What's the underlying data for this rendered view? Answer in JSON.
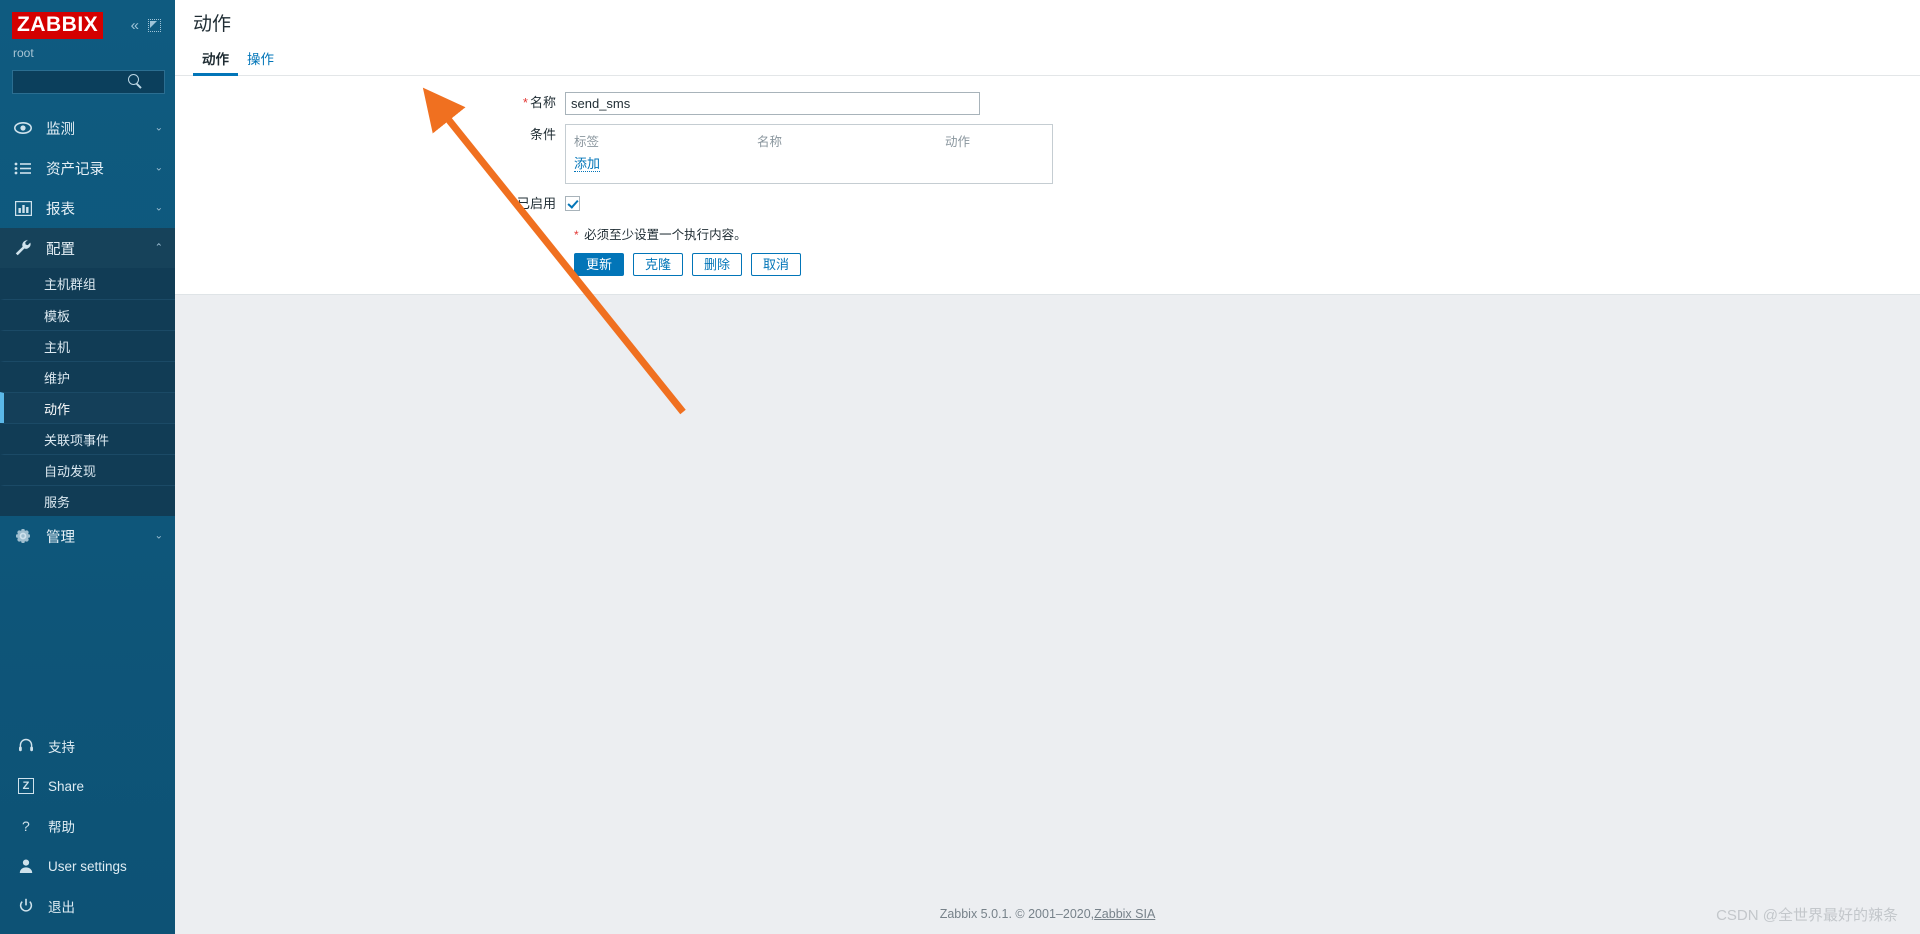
{
  "sidebar": {
    "logo": "ZABBIX",
    "user": "root",
    "search_placeholder": "",
    "search_value": "",
    "collapse_icon": "chevron-double-left-icon",
    "hide_icon": "collapse-sidebar-icon",
    "nav": [
      {
        "label": "监测",
        "icon": "eye-icon",
        "active": false,
        "chevron": "⌄"
      },
      {
        "label": "资产记录",
        "icon": "list-icon",
        "active": false,
        "chevron": "⌄"
      },
      {
        "label": "报表",
        "icon": "bar-chart-icon",
        "active": false,
        "chevron": "⌄"
      },
      {
        "label": "配置",
        "icon": "wrench-icon",
        "active": true,
        "chevron": "⌃"
      }
    ],
    "submenu": [
      {
        "label": "主机群组",
        "selected": false
      },
      {
        "label": "模板",
        "selected": false
      },
      {
        "label": "主机",
        "selected": false
      },
      {
        "label": "维护",
        "selected": false
      },
      {
        "label": "动作",
        "selected": true
      },
      {
        "label": "关联项事件",
        "selected": false
      },
      {
        "label": "自动发现",
        "selected": false
      },
      {
        "label": "服务",
        "selected": false
      }
    ],
    "nav_admin": {
      "label": "管理",
      "icon": "gear-icon",
      "chevron": "⌄"
    },
    "bottom": [
      {
        "label": "支持",
        "icon": "headset-icon"
      },
      {
        "label": "Share",
        "icon": "share-z-icon"
      },
      {
        "label": "帮助",
        "icon": "question-icon"
      },
      {
        "label": "User settings",
        "icon": "person-icon"
      },
      {
        "label": "退出",
        "icon": "power-icon"
      }
    ]
  },
  "header": {
    "title": "动作"
  },
  "tabs": [
    {
      "label": "动作",
      "active": true
    },
    {
      "label": "操作",
      "active": false
    }
  ],
  "form": {
    "name_label": "名称",
    "name_value": "send_sms",
    "name_required": "*",
    "conditions_label": "条件",
    "conditions_headers": [
      "标签",
      "名称",
      "动作"
    ],
    "conditions_rows": [],
    "add_link": "添加",
    "enabled_label": "已启用",
    "enabled_checked": true,
    "error_marker": "*",
    "error_text": "必须至少设置一个执行内容。"
  },
  "buttons": [
    {
      "label": "更新",
      "primary": true
    },
    {
      "label": "克隆",
      "primary": false
    },
    {
      "label": "删除",
      "primary": false
    },
    {
      "label": "取消",
      "primary": false
    }
  ],
  "footer": {
    "text": "Zabbix 5.0.1. © 2001–2020, ",
    "link": "Zabbix SIA"
  },
  "watermark": "CSDN @全世界最好的辣条",
  "colors": {
    "sidebar_bg": "#10527a",
    "logo_red": "#d40000",
    "accent_blue": "#0275b8",
    "required_red": "#e33734",
    "arrow_orange": "#f07020"
  }
}
